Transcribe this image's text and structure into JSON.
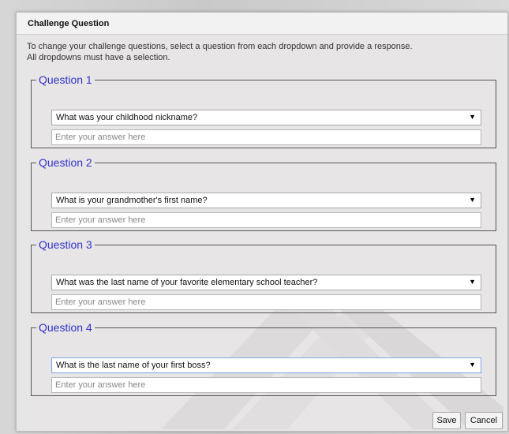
{
  "dialog": {
    "title": "Challenge Question",
    "instructions_line1": "To change your challenge questions, select a question from each dropdown and provide a response.",
    "instructions_line2": "All dropdowns must have a selection."
  },
  "questions": [
    {
      "legend": "Question 1",
      "selected": "What was your childhood nickname?",
      "answer_placeholder": "Enter your answer here"
    },
    {
      "legend": "Question 2",
      "selected": "What is your grandmother's first name?",
      "answer_placeholder": "Enter your answer here"
    },
    {
      "legend": "Question 3",
      "selected": "What was the last name of your favorite elementary school teacher?",
      "answer_placeholder": "Enter your answer here"
    },
    {
      "legend": "Question 4",
      "selected": "What is the last name of your first boss?",
      "answer_placeholder": "Enter your answer here"
    }
  ],
  "dropdown_arrow": "▼",
  "buttons": {
    "save_label": "Save",
    "cancel_label": "Cancel"
  },
  "colors": {
    "legend": "#3333cc",
    "content_bg": "#e7e5e5",
    "title_bar": "#f2f2f2"
  }
}
